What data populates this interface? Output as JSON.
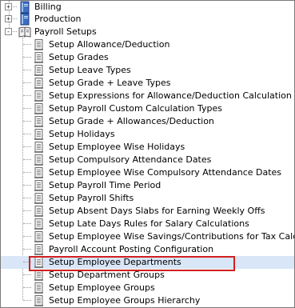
{
  "tree": {
    "top_nodes": [
      {
        "label": "Billing",
        "expander": "+",
        "icon": "book-icon"
      },
      {
        "label": "Production",
        "expander": "+",
        "icon": "book-icon"
      },
      {
        "label": "Payroll Setups",
        "expander": "-",
        "icon": "open-book-icon"
      }
    ],
    "payroll_children": [
      "Setup Allowance/Deduction",
      "Setup Grades",
      "Setup Leave Types",
      "Setup Grade + Leave Types",
      "Setup Expressions for Allowance/Deduction Calculation",
      "Setup Payroll Custom Calculation Types",
      "Setup Grade + Allowances/Deduction",
      "Setup Holidays",
      "Setup Employee Wise Holidays",
      "Setup Compulsory Attendance Dates",
      "Setup Employee Wise Compulsory Attendance Dates",
      "Setup Payroll Time Period",
      "Setup Payroll Shifts",
      "Setup Absent Days Slabs for Earning Weekly Offs",
      "Setup Late Days Rules for Salary Calculations",
      "Setup Employee Wise Savings/Contributions for Tax Calculation",
      "Payroll Account Posting Configuration",
      "Setup Employee Departments",
      "Setup Department Groups",
      "Setup Employee Groups",
      "Setup Employee Groups Hierarchy"
    ],
    "selected_item": "Setup Employee Departments",
    "child_icon": "document-icon"
  },
  "colors": {
    "selection_background": "#d8e6f7",
    "highlight_border": "#d21f1f",
    "book_blue": "#3c6fc4"
  }
}
